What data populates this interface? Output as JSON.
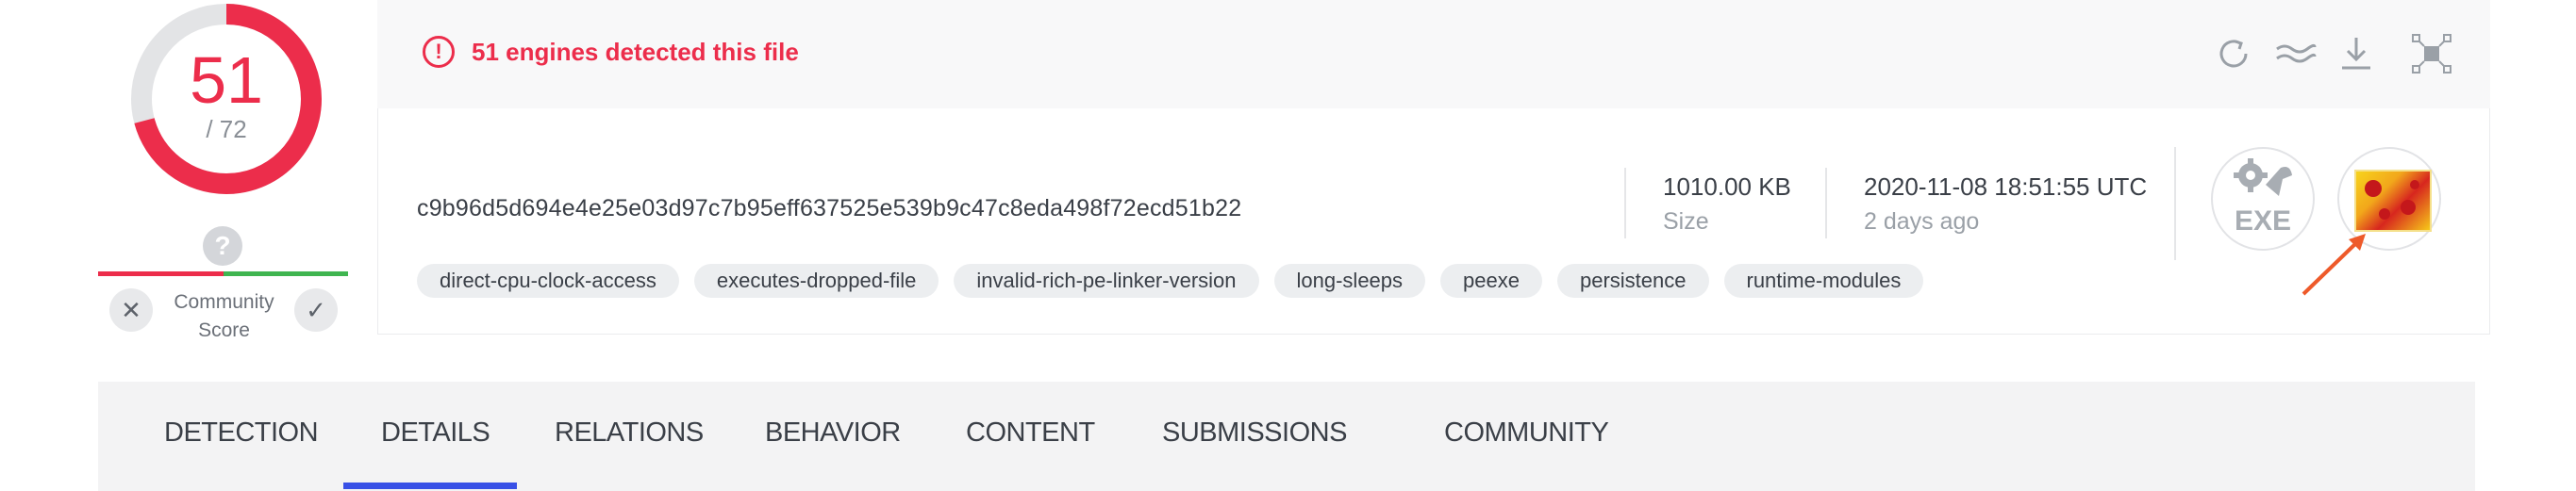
{
  "score": {
    "detections": "51",
    "total": "/ 72"
  },
  "community_score": {
    "help": "?",
    "label": "Community Score",
    "vote_down": "✕",
    "vote_up": "✓"
  },
  "alert": {
    "icon": "!",
    "text": "51 engines detected this file"
  },
  "toolbar": {
    "icons": [
      "reanalyze-icon",
      "similar-icon",
      "download-icon",
      "graph-icon"
    ]
  },
  "file": {
    "hash": "c9b96d5d694e4e25e03d97c7b95eff637525e539b9c47c8eda498f72ecd51b22",
    "tags": [
      "direct-cpu-clock-access",
      "executes-dropped-file",
      "invalid-rich-pe-linker-version",
      "long-sleeps",
      "peexe",
      "persistence",
      "runtime-modules"
    ],
    "size_value": "1010.00 KB",
    "size_label": "Size",
    "date_value": "2020-11-08 18:51:55 UTC",
    "date_label": "2 days ago",
    "type_label": "EXE"
  },
  "tabs": [
    "DETECTION",
    "DETAILS",
    "RELATIONS",
    "BEHAVIOR",
    "CONTENT",
    "SUBMISSIONS",
    "COMMUNITY"
  ],
  "active_tab": "DETAILS",
  "colors": {
    "alert_red": "#ec2d4b",
    "active_tab_underline": "#3850e6",
    "positive_green": "#3fb550"
  }
}
